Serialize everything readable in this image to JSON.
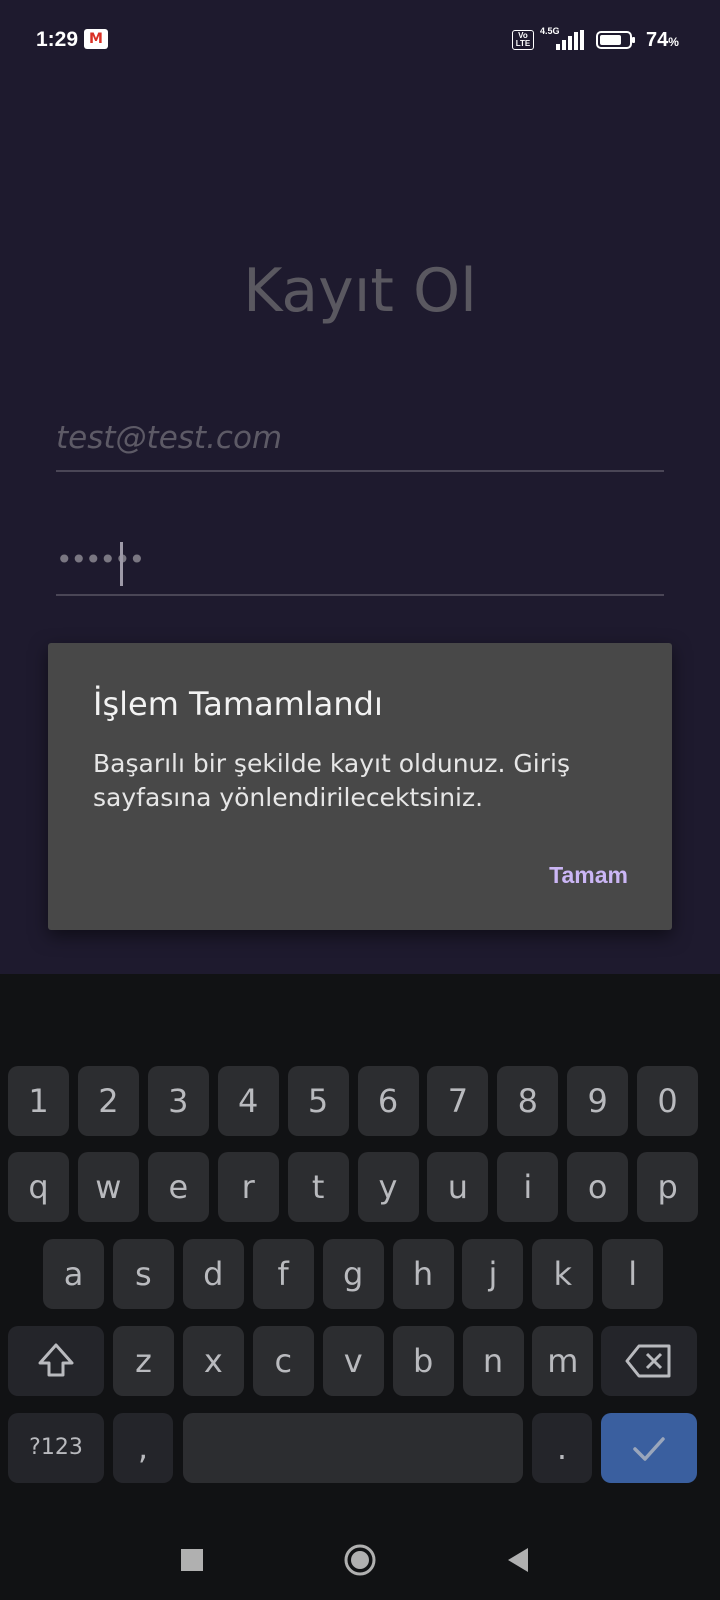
{
  "status_bar": {
    "time": "1:29",
    "gmail_glyph": "M",
    "volte": "Vo LTE",
    "network": "4.5G",
    "battery": "74",
    "battery_unit": "%"
  },
  "screen": {
    "title": "Kayıt Ol",
    "email_value": "test@test.com",
    "password_value": "••••••"
  },
  "dialog": {
    "title": "İşlem Tamamlandı",
    "message": "Başarılı bir şekilde kayıt oldunuz. Giriş sayfasına yönlendirilecektsiniz.",
    "ok_label": "Tamam"
  },
  "keyboard": {
    "row_numbers": [
      "1",
      "2",
      "3",
      "4",
      "5",
      "6",
      "7",
      "8",
      "9",
      "0"
    ],
    "row_top": [
      "q",
      "w",
      "e",
      "r",
      "t",
      "y",
      "u",
      "i",
      "o",
      "p"
    ],
    "row_middle": [
      "a",
      "s",
      "d",
      "f",
      "g",
      "h",
      "j",
      "k",
      "l"
    ],
    "row_bottom": [
      "z",
      "x",
      "c",
      "v",
      "b",
      "n",
      "m"
    ],
    "symbols_label": "?123",
    "comma_label": ",",
    "period_label": ".",
    "shift_icon": "shift-icon",
    "backspace_icon": "backspace-icon",
    "enter_icon": "check-icon"
  },
  "colors": {
    "app_background": "#1e1a2e",
    "dialog_background": "#484848",
    "dialog_accent": "#cbb6f5",
    "enter_key": "#3a5f9f"
  }
}
